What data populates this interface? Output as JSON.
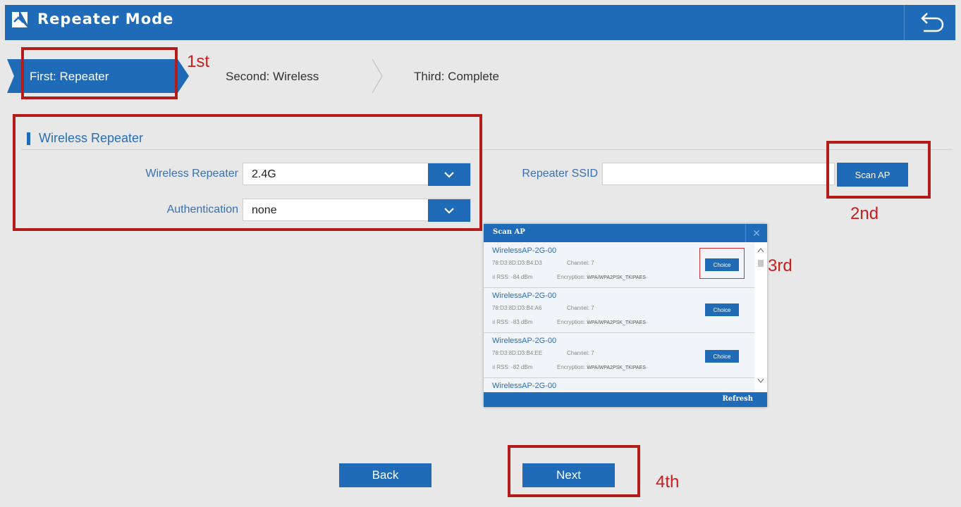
{
  "header": {
    "title": "Repeater Mode"
  },
  "steps": [
    {
      "label": "First: Repeater"
    },
    {
      "label": "Second: Wireless"
    },
    {
      "label": "Third: Complete"
    }
  ],
  "section": {
    "title": "Wireless Repeater"
  },
  "form": {
    "wireless_repeater_label": "Wireless Repeater",
    "wireless_repeater_value": "2.4G",
    "authentication_label": "Authentication",
    "authentication_value": "none",
    "repeater_ssid_label": "Repeater SSID",
    "repeater_ssid_value": "",
    "scan_ap_label": "Scan AP"
  },
  "popup": {
    "title": "Scan AP",
    "choice_label": "Choice",
    "refresh_label": "Refresh",
    "channel_prefix": "Channel:",
    "rss_prefix": "RSS:",
    "encryption_prefix": "Encryption:",
    "items": [
      {
        "ssid": "WirelessAP-2G-00",
        "mac": "78:D3:8D:D3:B4:D3",
        "channel": "7",
        "rss": "-84 dBm",
        "encryption": "WPA/WPA2PSK_TKIPAES"
      },
      {
        "ssid": "WirelessAP-2G-00",
        "mac": "78:D3:8D:D3:B4:A6",
        "channel": "7",
        "rss": "-83 dBm",
        "encryption": "WPA/WPA2PSK_TKIPAES"
      },
      {
        "ssid": "WirelessAP-2G-00",
        "mac": "78:D3:8D:D3:B4:EE",
        "channel": "7",
        "rss": "-82 dBm",
        "encryption": "WPA/WPA2PSK_TKIPAES"
      },
      {
        "ssid": "WirelessAP-2G-00"
      }
    ]
  },
  "buttons": {
    "back": "Back",
    "next": "Next"
  },
  "annotations": {
    "first": "1st",
    "second": "2nd",
    "third": "3rd",
    "fourth": "4th"
  },
  "colors": {
    "brand": "#1f6bb8",
    "annotation": "#b41b1b"
  }
}
